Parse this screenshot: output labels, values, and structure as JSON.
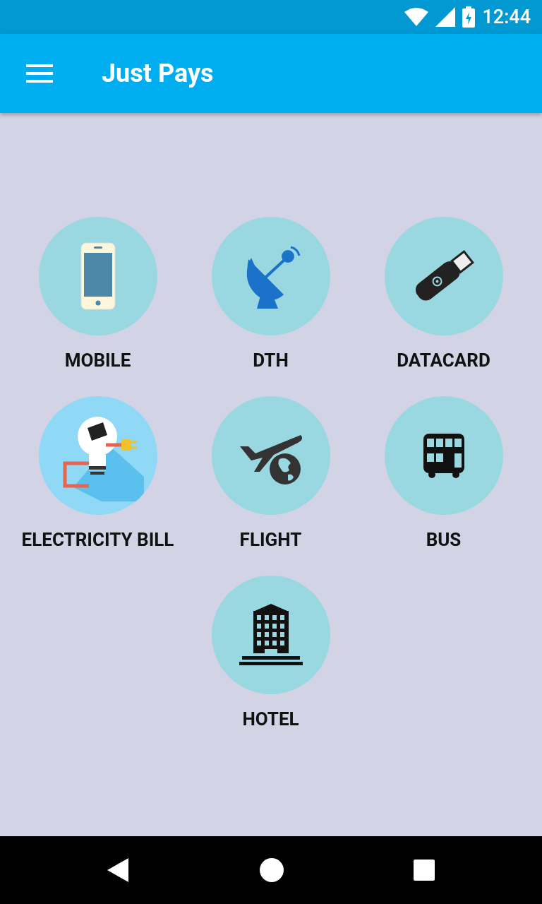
{
  "status_bar": {
    "time": "12:44"
  },
  "app_bar": {
    "title": "Just Pays"
  },
  "services": [
    {
      "label": "MOBILE",
      "kind": "phone"
    },
    {
      "label": "DTH",
      "kind": "dish"
    },
    {
      "label": "DATACARD",
      "kind": "usb"
    },
    {
      "label": "ELECTRICITY BILL",
      "kind": "bulb"
    },
    {
      "label": "FLIGHT",
      "kind": "plane"
    },
    {
      "label": "BUS",
      "kind": "bus"
    },
    {
      "label": "HOTEL",
      "kind": "hotel"
    }
  ]
}
